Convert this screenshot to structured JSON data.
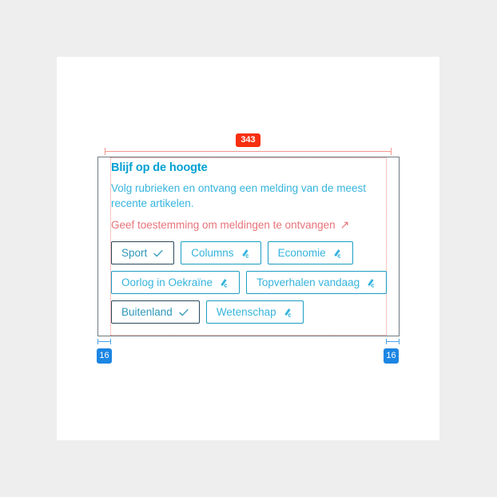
{
  "annotations": {
    "width_badge": "343",
    "padding_left_badge": "16",
    "padding_right_badge": "16"
  },
  "card": {
    "title": "Blijf op de hoogte",
    "body": "Volg rubrieken en ontvang een melding van de meest recente artikelen.",
    "permission_link": {
      "label": "Geef toestemming om meldingen te ontvangen",
      "icon": "arrow-up-right-icon",
      "glyph": "↗"
    },
    "chip_rows": [
      [
        {
          "label": "Sport",
          "icon": "check-icon",
          "followed": true
        },
        {
          "label": "Columns",
          "icon": "bell-icon",
          "followed": false
        },
        {
          "label": "Economie",
          "icon": "bell-icon",
          "followed": false
        }
      ],
      [
        {
          "label": "Oorlog in Oekraïne",
          "icon": "bell-icon",
          "followed": false
        },
        {
          "label": "Topverhalen vandaag",
          "icon": "bell-icon",
          "followed": false
        }
      ],
      [
        {
          "label": "Buitenland",
          "icon": "check-icon",
          "followed": true
        },
        {
          "label": "Wetenschap",
          "icon": "bell-icon",
          "followed": false
        }
      ]
    ]
  },
  "colors": {
    "page_background": "#eeeeee",
    "artboard": "#ffffff",
    "title": "#00a0d2",
    "body_text": "#36b4dd",
    "link_text": "#e8737a",
    "chip_border": "#1c9dc4",
    "chip_border_followed": "#2b4a5a",
    "measure_red": "#f62f10",
    "measure_red_line": "#f4978f",
    "measure_blue": "#1c86e3",
    "padding_band": "#e3f1fd"
  }
}
